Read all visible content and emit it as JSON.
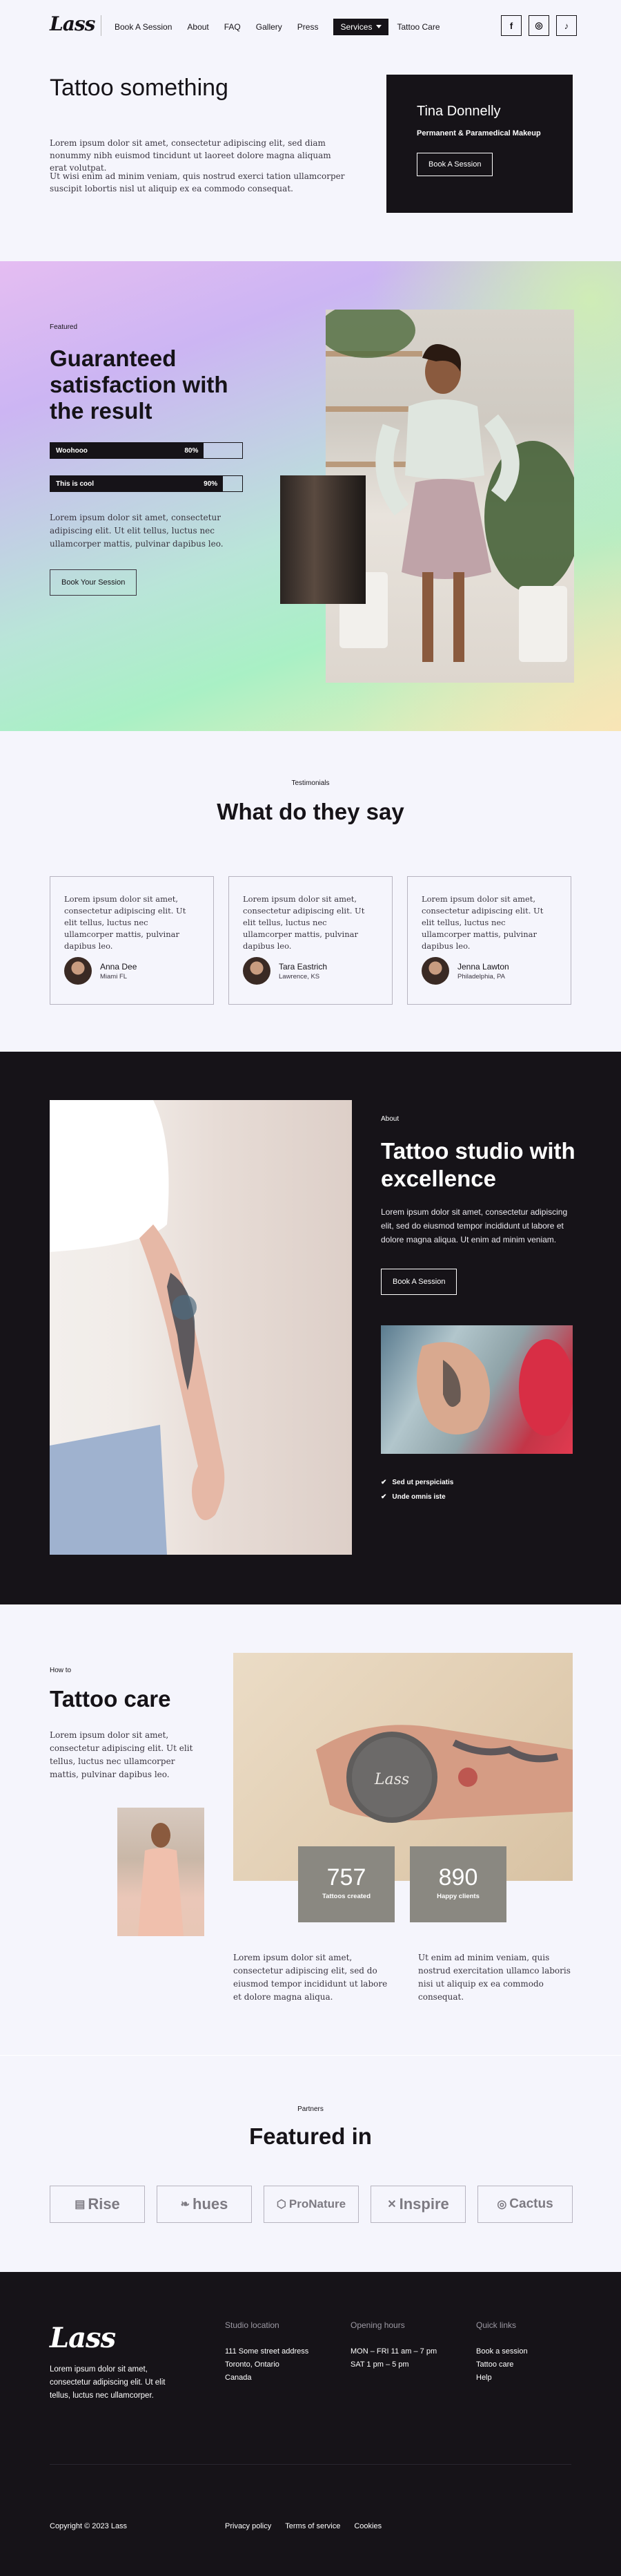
{
  "header": {
    "logo": "Lass",
    "nav": [
      "Book A Session",
      "About",
      "FAQ",
      "Gallery",
      "Press"
    ],
    "nav_active": "Services",
    "nav_after": "Tattoo Care",
    "social_icons": [
      "facebook-icon",
      "instagram-icon",
      "tiktok-icon"
    ],
    "social_glyphs": [
      "f",
      "◎",
      "♪"
    ]
  },
  "hero": {
    "title": "Tattoo something",
    "paragraph1": "Lorem ipsum dolor sit amet, consectetur adipiscing elit, sed diam nonummy nibh euismod tincidunt ut laoreet dolore magna aliquam erat volutpat.",
    "paragraph2": "Ut wisi enim ad minim veniam, quis nostrud exerci tation ullamcorper suscipit lobortis nisl ut aliquip ex ea commodo consequat.",
    "card": {
      "name": "Tina Donnelly",
      "role": "Permanent & Paramedical Makeup",
      "button": "Book A Session"
    }
  },
  "featured": {
    "kicker": "Featured",
    "title": "Guaranteed satisfaction with the result",
    "bars": [
      {
        "label": "Woohooo",
        "value_text": "80%",
        "value": 0.8
      },
      {
        "label": "This is cool",
        "value_text": "90%",
        "value": 0.9
      }
    ],
    "paragraph": "Lorem ipsum dolor sit amet, consectetur adipiscing elit. Ut elit tellus, luctus nec ullamcorper mattis, pulvinar dapibus leo.",
    "button": "Book Your Session"
  },
  "testimonials": {
    "kicker": "Testimonials",
    "title": "What do they say",
    "items": [
      {
        "text": "Lorem ipsum dolor sit amet, consectetur adipiscing elit. Ut elit tellus, luctus nec ullamcorper mattis, pulvinar dapibus leo.",
        "name": "Anna Dee",
        "location": "Miami FL"
      },
      {
        "text": "Lorem ipsum dolor sit amet, consectetur adipiscing elit. Ut elit tellus, luctus nec ullamcorper mattis, pulvinar dapibus leo.",
        "name": "Tara Eastrich",
        "location": "Lawrence, KS"
      },
      {
        "text": "Lorem ipsum dolor sit amet, consectetur adipiscing elit. Ut elit tellus, luctus nec ullamcorper mattis, pulvinar dapibus leo.",
        "name": "Jenna Lawton",
        "location": "Philadelphia, PA"
      }
    ]
  },
  "about": {
    "kicker": "About",
    "title": "Tattoo studio with excellence",
    "paragraph": "Lorem ipsum dolor sit amet, consectetur adipiscing elit, sed do eiusmod tempor incididunt ut labore et dolore magna aliqua. Ut enim ad minim veniam.",
    "button": "Book A Session",
    "checks": [
      "Sed ut perspiciatis",
      "Unde omnis iste"
    ]
  },
  "care": {
    "kicker": "How to",
    "title": "Tattoo care",
    "paragraph": "Lorem ipsum dolor sit amet, consectetur adipiscing elit. Ut elit tellus, luctus nec ullamcorper mattis, pulvinar dapibus leo.",
    "stats": [
      {
        "number": "757",
        "label": "Tattoos created"
      },
      {
        "number": "890",
        "label": "Happy clients"
      }
    ],
    "paragraph2": "Lorem ipsum dolor sit amet, consectetur adipiscing elit, sed do eiusmod tempor incididunt ut labore et dolore magna aliqua.",
    "paragraph3": "Ut enim ad minim veniam, quis nostrud exercitation ullamco laboris nisi ut aliquip ex ea commodo consequat.",
    "jar_label": "Lass"
  },
  "partners": {
    "kicker": "Partners",
    "title": "Featured in",
    "logos": [
      {
        "name": "Rise",
        "icon": "rise-logo-icon",
        "glyph": "▤"
      },
      {
        "name": "hues",
        "icon": "hues-logo-icon",
        "glyph": "❧"
      },
      {
        "name": "ProNature",
        "icon": "pronature-logo-icon",
        "glyph": "⬡"
      },
      {
        "name": "Inspire",
        "icon": "inspire-logo-icon",
        "glyph": "✕"
      },
      {
        "name": "Cactus",
        "icon": "cactus-logo-icon",
        "glyph": "◎"
      }
    ]
  },
  "footer": {
    "logo": "Lass",
    "about": "Lorem ipsum dolor sit amet, consectetur adipiscing elit. Ut elit tellus, luctus nec ullamcorper.",
    "location_title": "Studio location",
    "location_lines": [
      "111 Some street address",
      "Toronto, Ontario",
      "Canada"
    ],
    "hours_title": "Opening hours",
    "hours_lines": [
      "MON – FRI 11 am – 7 pm",
      "SAT 1 pm – 5 pm"
    ],
    "links_title": "Quick links",
    "links": [
      "Book a session",
      "Tattoo care",
      "Help"
    ],
    "copyright": "Copyright © 2023 Lass",
    "bottom_links": [
      "Privacy policy",
      "Terms of service",
      "Cookies"
    ]
  }
}
